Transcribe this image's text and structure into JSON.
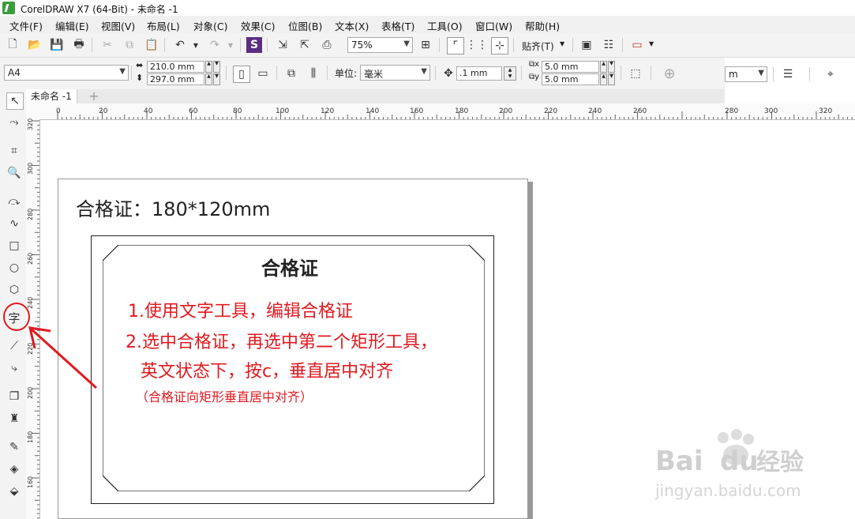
{
  "window": {
    "title": "CorelDRAW X7 (64-Bit) - 未命名 -1"
  },
  "menu": [
    "文件(F)",
    "编辑(E)",
    "视图(V)",
    "布局(L)",
    "对象(C)",
    "效果(C)",
    "位图(B)",
    "文本(X)",
    "表格(T)",
    "工具(O)",
    "窗口(W)",
    "帮助(H)"
  ],
  "toolbar": {
    "zoom": "75%",
    "snap_label": "贴齐(T)"
  },
  "propertybar": {
    "page_size": "A4",
    "width": "210.0 mm",
    "height": "297.0 mm",
    "units_label": "单位:",
    "units_value": "毫米",
    "nudge": ".1 mm",
    "dup_x": "5.0 mm",
    "dup_y": "5.0 mm",
    "right_combo": "m"
  },
  "tabs": {
    "doc_tab": "未命名 -1",
    "add": "+"
  },
  "ruler": {
    "h_labels": [
      "0",
      "20",
      "40",
      "60",
      "80",
      "100",
      "120",
      "140",
      "160",
      "180",
      "200",
      "220",
      "240",
      "260",
      "280",
      "300",
      "320"
    ],
    "v_labels": [
      "320",
      "300",
      "280",
      "260",
      "240",
      "220",
      "200",
      "180",
      "160"
    ]
  },
  "canvas": {
    "heading": "合格证：180*120mm",
    "cert_title": "合格证",
    "notes": [
      "1.使用文字工具，编辑合格证",
      "2.选中合格证，再选中第二个矩形工具，",
      "英文状态下，按c，垂直居中对齐",
      "（合格证向矩形垂直居中对齐）"
    ]
  },
  "toolbox": {
    "text_tool": "字"
  },
  "watermark": {
    "brand1": "Bai",
    "brand2": "du",
    "brand3": "经验",
    "url": "jingyan.baidu.com"
  },
  "colors": {
    "annotation_red": "#e0191f"
  }
}
